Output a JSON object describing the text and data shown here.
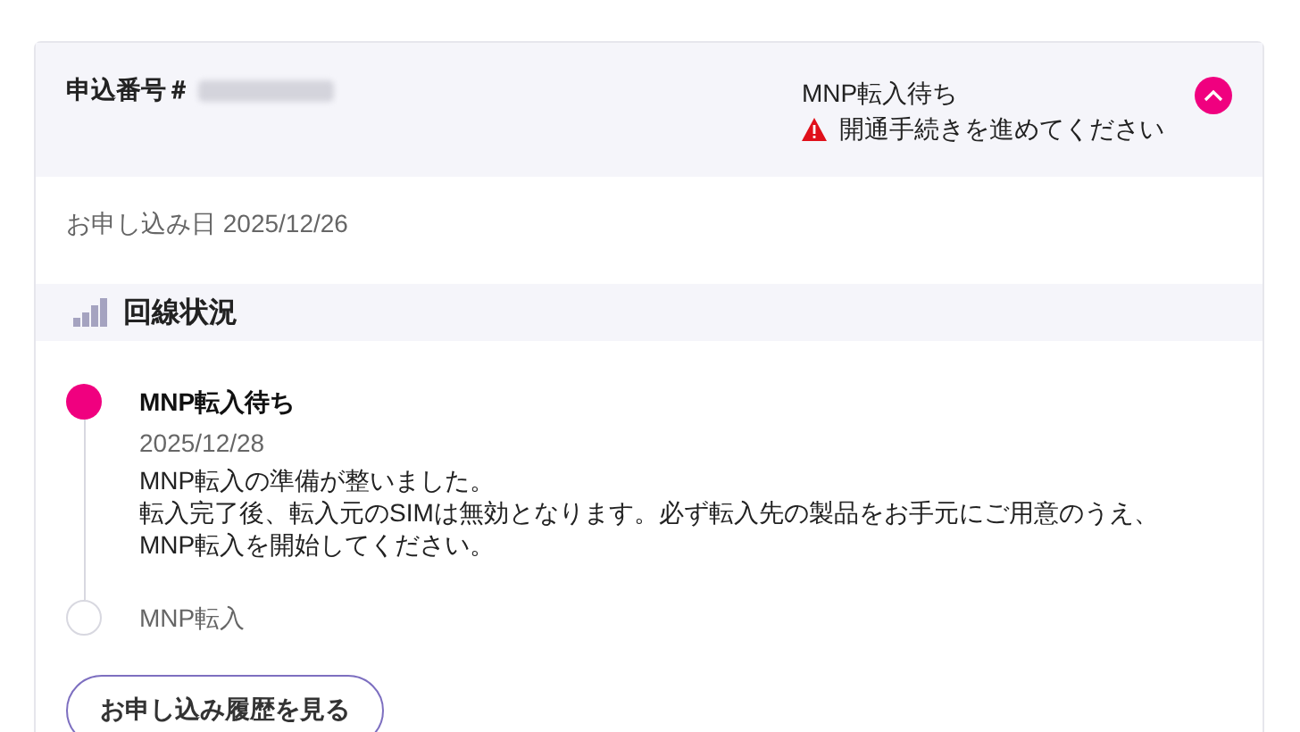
{
  "header": {
    "order_label": "申込番号＃",
    "status": "MNP転入待ち",
    "alert": "開通手続きを進めてください",
    "expanded": true
  },
  "applied_date": "お申し込み日 2025/12/26",
  "section": {
    "title": "回線状況"
  },
  "timeline": [
    {
      "title": "MNP転入待ち",
      "active": true,
      "date": "2025/12/28",
      "description": [
        "MNP転入の準備が整いました。",
        "転入完了後、転入元のSIMは無効となります。必ず転入先の製品をお手元にご用意のうえ、",
        "MNP転入を開始してください。"
      ]
    },
    {
      "title": "MNP転入",
      "active": false
    }
  ],
  "history_button": "お申し込み履歴を見る"
}
